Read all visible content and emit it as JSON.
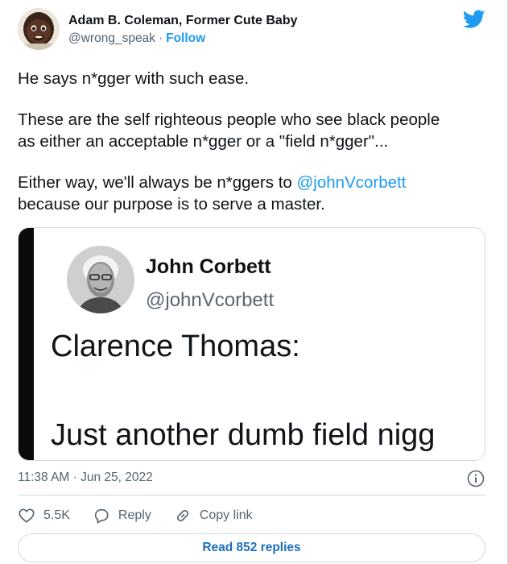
{
  "author": {
    "name": "Adam B. Coleman, Former Cute Baby",
    "handle": "@wrong_speak",
    "separator": "·",
    "follow_label": "Follow"
  },
  "tweet": {
    "paragraph1": "He says n*gger with such ease.",
    "paragraph2_line1": "These are the self righteous people who see black people",
    "paragraph2_line2": "as either an acceptable n*gger or a \"field n*gger\"...",
    "paragraph3_line1_prefix": "Either way, we'll always be n*ggers to ",
    "mention": "@johnVcorbett",
    "paragraph3_line2": "because our purpose is to serve a master."
  },
  "embedded_image": {
    "name": "John Corbett",
    "handle": "@johnVcorbett",
    "line1": "Clarence Thomas:",
    "line2": "Just another dumb field nigg"
  },
  "meta": {
    "timestamp": "11:38 AM · Jun 25, 2022"
  },
  "actions": {
    "like_count": "5.5K",
    "reply_label": "Reply",
    "copy_link_label": "Copy link"
  },
  "read_replies_label": "Read 852 replies",
  "icons": {
    "brand": "twitter-bird-icon",
    "info": "info-icon",
    "like": "heart-icon",
    "reply": "speech-bubble-icon",
    "copy": "link-icon"
  },
  "colors": {
    "accent": "#1d9bf0",
    "link_dark": "#1d6fc0",
    "secondary_text": "#536471",
    "border": "#cfd9de"
  }
}
